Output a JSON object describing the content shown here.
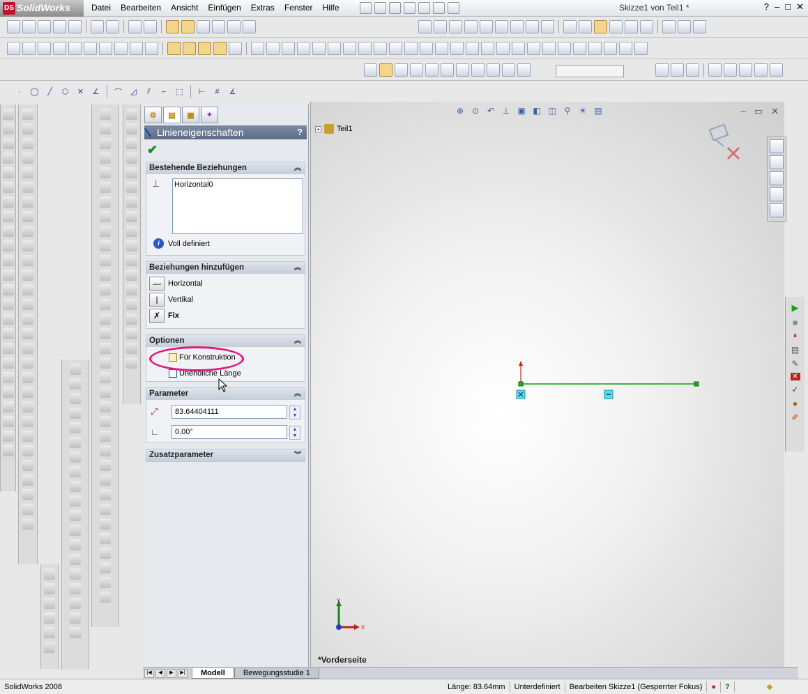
{
  "app": {
    "name": "SolidWorks",
    "logo_badge": "DS",
    "document_title": "Skizze1 von Teil1 *"
  },
  "menu": [
    "Datei",
    "Bearbeiten",
    "Ansicht",
    "Einfügen",
    "Extras",
    "Fenster",
    "Hilfe"
  ],
  "window_controls": {
    "help": "?",
    "minimize": "–",
    "restore": "□",
    "close": "✕"
  },
  "property_manager": {
    "title": "Linieneigenschaften",
    "help": "?",
    "ok": "✔",
    "existing_relations": {
      "header": "Bestehende Beziehungen",
      "items": [
        "Horizontal0"
      ],
      "status": "Voll definiert"
    },
    "add_relations": {
      "header": "Beziehungen hinzufügen",
      "items": [
        {
          "label": "Horizontal",
          "icon": "horizontal-relation-icon"
        },
        {
          "label": "Vertikal",
          "icon": "vertical-relation-icon"
        },
        {
          "label": "Fix",
          "icon": "fix-relation-icon"
        }
      ]
    },
    "options": {
      "header": "Optionen",
      "construction": {
        "label": "Für Konstruktion",
        "checked": false
      },
      "infinite": {
        "label": "Unendliche Länge",
        "checked": false
      }
    },
    "parameters": {
      "header": "Parameter",
      "length": "83.64404111",
      "angle": "0.00°"
    },
    "extra_parameters": {
      "header": "Zusatzparameter"
    }
  },
  "feature_tree": {
    "root": "Teil1"
  },
  "graphics": {
    "view_label": "*Vorderseite",
    "axis_x": "X",
    "axis_y": "Y"
  },
  "bottom_tabs": [
    "Modell",
    "Bewegungsstudie 1"
  ],
  "status_bar": {
    "product": "SolidWorks 2008",
    "length": "Länge: 83.64mm",
    "definition": "Unterdefiniert",
    "mode": "Bearbeiten Skizze1 (Gesperrter Fokus)",
    "help": "?"
  },
  "colors": {
    "highlight_circle": "#e0197c",
    "sketch_line": "#20b020",
    "title_bar": "#5c6a84"
  }
}
